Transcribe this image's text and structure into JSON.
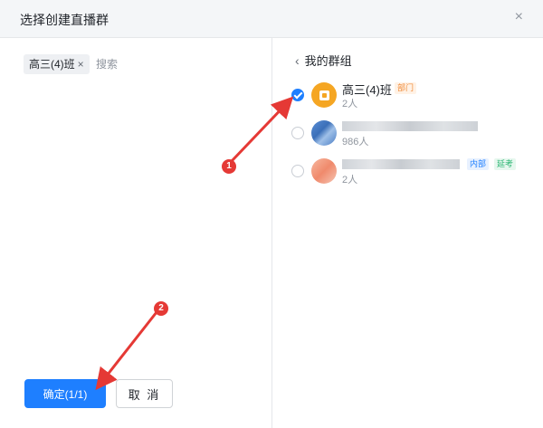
{
  "dialog": {
    "title": "选择创建直播群",
    "close_icon": "×"
  },
  "left": {
    "selected_chip": {
      "label": "高三(4)班",
      "remove_icon": "×"
    },
    "search": {
      "placeholder": "搜索",
      "value": ""
    },
    "confirm_label": "确定(1/1)",
    "cancel_label": "取 消"
  },
  "right": {
    "breadcrumb": {
      "back_icon": "‹",
      "label": "我的群组"
    },
    "groups": [
      {
        "name": "高三(4)班",
        "sub": "2人",
        "tag": "部门",
        "checked": true,
        "avatar": "orange"
      },
      {
        "name": "",
        "sub": "986人",
        "checked": false,
        "avatar": "photo"
      },
      {
        "name": "",
        "sub": "2人",
        "tags": [
          "内部",
          "延考"
        ],
        "checked": false,
        "avatar": "peach"
      }
    ]
  },
  "annotations": {
    "markers": [
      "1",
      "2"
    ],
    "color": "#e53935"
  },
  "colors": {
    "primary": "#1e7fff",
    "header_bg": "#f4f6f8",
    "annotation_red": "#e53935"
  }
}
